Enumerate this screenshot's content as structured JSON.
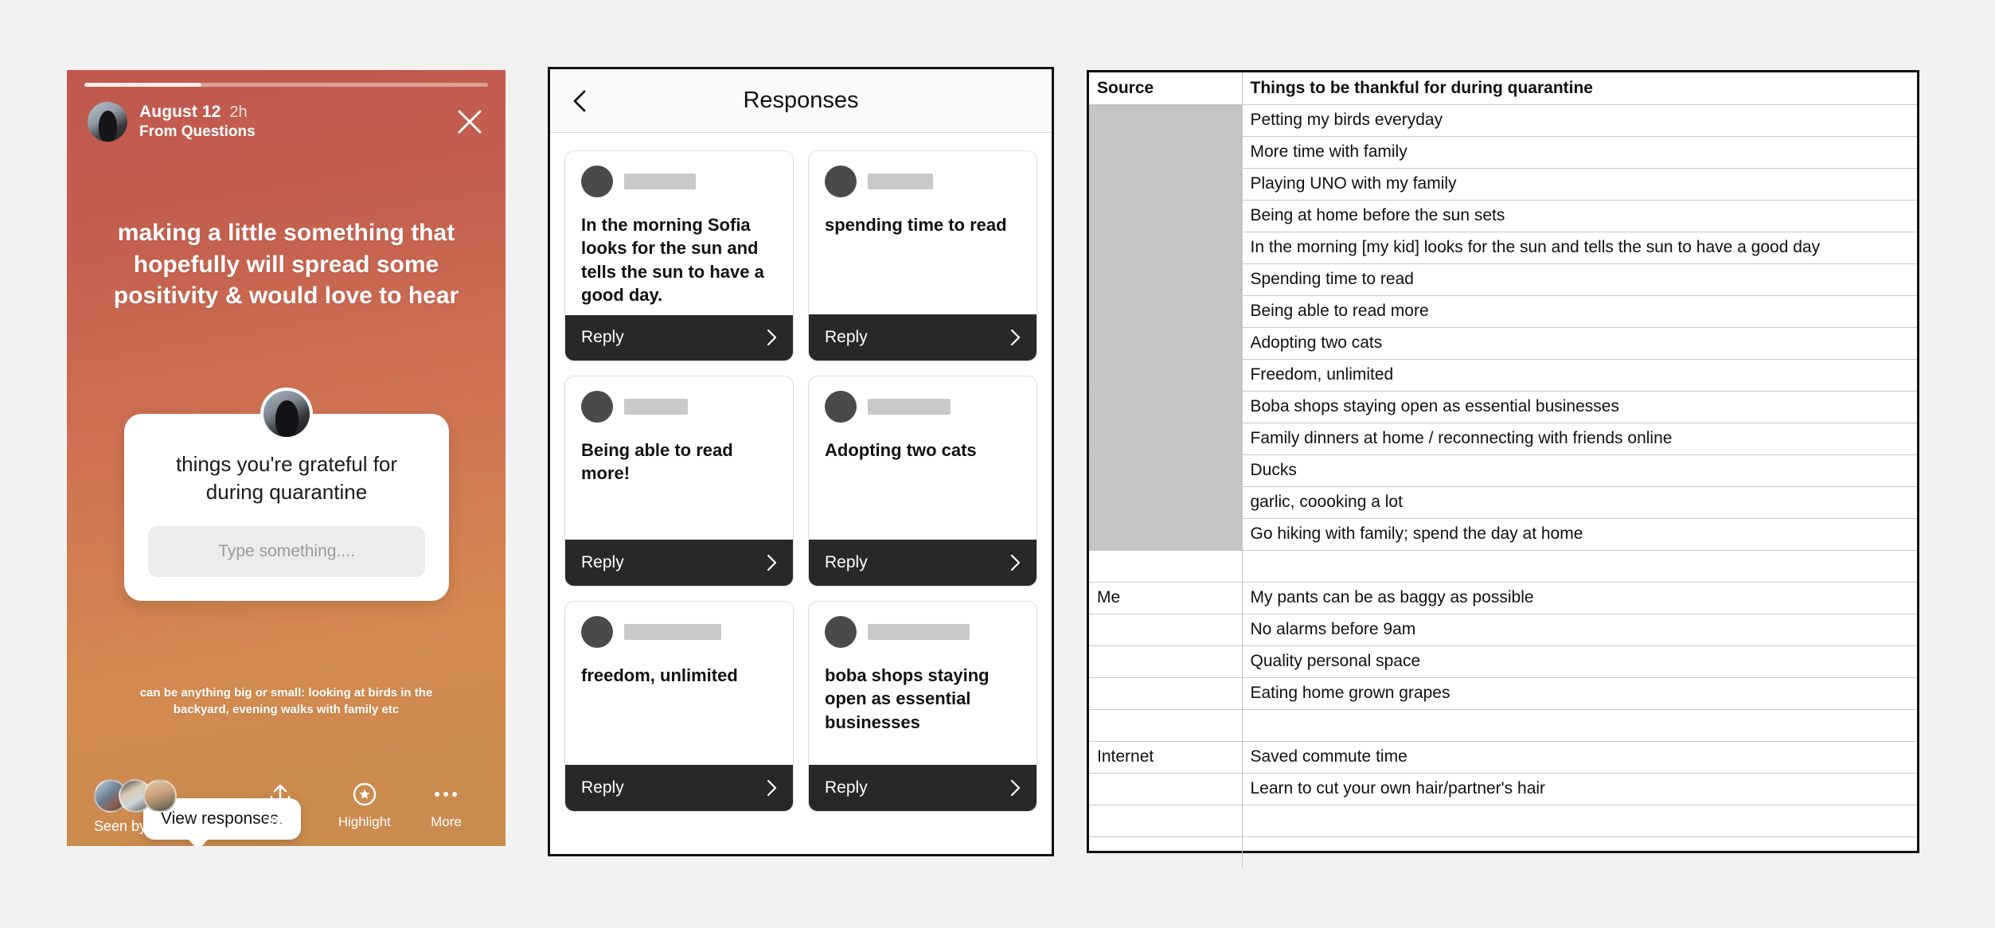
{
  "story": {
    "date": "August 12",
    "time_ago": "2h",
    "source": "From Questions",
    "title": "making a little something that hopefully will spread some positivity & would love to hear",
    "question_prompt": "things you're grateful for during quarantine",
    "input_placeholder": "Type something....",
    "caption": "can be anything big or small: looking at birds in the backyard, evening walks with family etc",
    "tooltip": "View responses.",
    "seen_by": "Seen by 89",
    "actions": [
      {
        "label": "Share",
        "icon": "share-icon"
      },
      {
        "label": "Highlight",
        "icon": "highlight-icon"
      },
      {
        "label": "More",
        "icon": "more-icon"
      }
    ]
  },
  "responses_panel": {
    "title": "Responses",
    "back_icon": "back-chevron-icon",
    "reply_label": "Reply",
    "cards": [
      {
        "text": "In the morning Sofia looks for the sun and tells the sun to have a good day.",
        "name_bar_width": 90
      },
      {
        "text": "spending time to read",
        "name_bar_width": 82
      },
      {
        "text": "Being able to read more!",
        "name_bar_width": 80
      },
      {
        "text": "Adopting two cats",
        "name_bar_width": 104
      },
      {
        "text": "freedom, unlimited",
        "name_bar_width": 122
      },
      {
        "text": "boba shops staying open as essential businesses",
        "name_bar_width": 128
      }
    ]
  },
  "sheet": {
    "headers": [
      "Source",
      "Things to be thankful for during quarantine"
    ],
    "rows": [
      {
        "source": "",
        "shaded": true,
        "item": "Petting my birds everyday"
      },
      {
        "source": "",
        "shaded": true,
        "item": "More time with family"
      },
      {
        "source": "",
        "shaded": true,
        "item": "Playing UNO with my family"
      },
      {
        "source": "",
        "shaded": true,
        "item": "Being at home before the sun sets"
      },
      {
        "source": "",
        "shaded": true,
        "item": "In the morning [my kid] looks for the sun and tells the sun to have a good day"
      },
      {
        "source": "",
        "shaded": true,
        "item": "Spending time to read"
      },
      {
        "source": "",
        "shaded": true,
        "item": "Being able to read more"
      },
      {
        "source": "",
        "shaded": true,
        "item": "Adopting two cats"
      },
      {
        "source": "",
        "shaded": true,
        "item": "Freedom, unlimited"
      },
      {
        "source": "",
        "shaded": true,
        "item": "Boba shops staying open as essential businesses"
      },
      {
        "source": "",
        "shaded": true,
        "item": "Family dinners at home / reconnecting with friends online"
      },
      {
        "source": "",
        "shaded": true,
        "item": "Ducks"
      },
      {
        "source": "",
        "shaded": true,
        "item": "garlic, coooking a lot"
      },
      {
        "source": "",
        "shaded": true,
        "item": "Go hiking with family; spend the day at home"
      },
      {
        "source": "",
        "shaded": false,
        "item": ""
      },
      {
        "source": "Me",
        "shaded": false,
        "item": "My pants can be as baggy as possible"
      },
      {
        "source": "",
        "shaded": false,
        "item": "No alarms before 9am"
      },
      {
        "source": "",
        "shaded": false,
        "item": "Quality personal space"
      },
      {
        "source": "",
        "shaded": false,
        "item": "Eating home grown grapes"
      },
      {
        "source": "",
        "shaded": false,
        "item": ""
      },
      {
        "source": "Internet",
        "shaded": false,
        "item": "Saved commute time"
      },
      {
        "source": "",
        "shaded": false,
        "item": "Learn to cut your own hair/partner's hair"
      },
      {
        "source": "",
        "shaded": false,
        "item": ""
      },
      {
        "source": "",
        "shaded": false,
        "item": ""
      }
    ]
  }
}
